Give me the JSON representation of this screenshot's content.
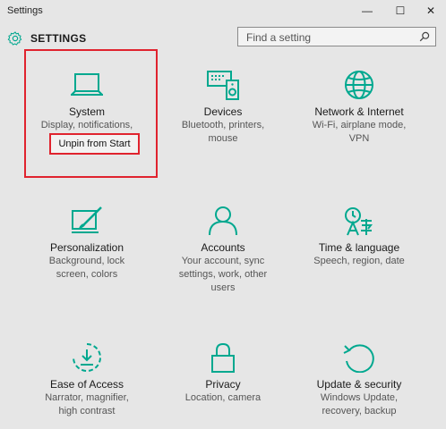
{
  "window": {
    "title": "Settings",
    "minimize_glyph": "—",
    "maximize_glyph": "☐",
    "close_glyph": "✕"
  },
  "header": {
    "title": "SETTINGS",
    "icon": "gear-icon"
  },
  "search": {
    "placeholder": "Find a setting",
    "icon": "search-icon"
  },
  "accent_color": "#00a88f",
  "highlight_color": "#e0232e",
  "tiles": [
    {
      "label": "System",
      "desc": [
        "Display, notifications,"
      ],
      "icon": "laptop-icon"
    },
    {
      "label": "Devices",
      "desc": [
        "Bluetooth, printers,",
        "mouse"
      ],
      "icon": "devices-icon"
    },
    {
      "label": "Network & Internet",
      "desc": [
        "Wi-Fi, airplane mode,",
        "VPN"
      ],
      "icon": "globe-icon"
    },
    {
      "label": "Personalization",
      "desc": [
        "Background, lock",
        "screen, colors"
      ],
      "icon": "paintbrush-icon"
    },
    {
      "label": "Accounts",
      "desc": [
        "Your account, sync",
        "settings, work, other",
        "users"
      ],
      "icon": "person-icon"
    },
    {
      "label": "Time & language",
      "desc": [
        "Speech, region, date"
      ],
      "icon": "time-language-icon"
    },
    {
      "label": "Ease of Access",
      "desc": [
        "Narrator, magnifier,",
        "high contrast"
      ],
      "icon": "ease-of-access-icon"
    },
    {
      "label": "Privacy",
      "desc": [
        "Location, camera"
      ],
      "icon": "lock-icon"
    },
    {
      "label": "Update & security",
      "desc": [
        "Windows Update,",
        "recovery, backup"
      ],
      "icon": "update-icon"
    }
  ],
  "context_tooltip": {
    "text": "Unpin from Start"
  }
}
